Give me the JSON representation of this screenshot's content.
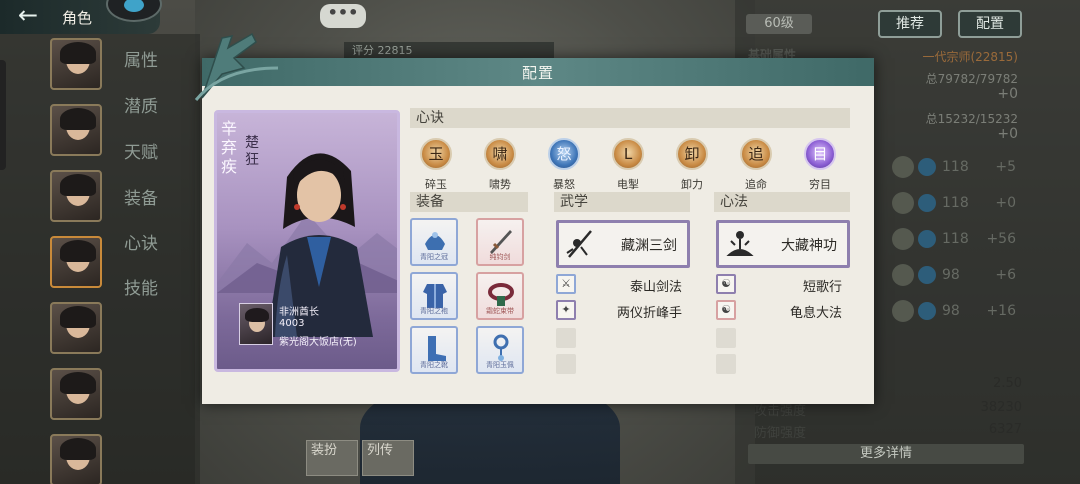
{
  "header": {
    "back_label": "←",
    "title": "角色"
  },
  "side_menu": [
    "属性",
    "潜质",
    "天赋",
    "装备",
    "心诀",
    "技能"
  ],
  "top_right": {
    "level": "60级",
    "recommend": "推荐",
    "config": "配置"
  },
  "chat_bubble": "•••",
  "score_text": "评分 22815",
  "stats_panel": {
    "heading": "基础属性",
    "rank": "一代宗师(22815)",
    "hp_line": "总79782/79782",
    "hp_delta": "+0",
    "mp_line": "总15232/15232",
    "mp_delta": "+0"
  },
  "wuxue_rows": [
    {
      "value": "118",
      "delta": "+5"
    },
    {
      "value": "118",
      "delta": "+0"
    },
    {
      "value": "118",
      "delta": "+56"
    },
    {
      "value": "98",
      "delta": "+6"
    },
    {
      "value": "98",
      "delta": "+16"
    }
  ],
  "lower_stats": [
    {
      "label": "",
      "value": "2.50"
    },
    {
      "label": "攻击强度",
      "value": "38230"
    },
    {
      "label": "防御强度",
      "value": "6327"
    }
  ],
  "more_details": "更多详情",
  "bottom_buttons": [
    "装扮",
    "列传"
  ],
  "modal": {
    "title": "配置",
    "character": {
      "name": "辛弃疾",
      "title": "楚狂",
      "owner_name": "非洲酋长",
      "owner_id": "4003",
      "owner_guild": "紫光阁大饭店(无)"
    },
    "xinjue_header": "心诀",
    "xinjue": [
      {
        "label": "碎玉",
        "glyph": "玉",
        "tone": "gold"
      },
      {
        "label": "啸势",
        "glyph": "啸",
        "tone": "gold"
      },
      {
        "label": "暴怒",
        "glyph": "怒",
        "tone": "blue"
      },
      {
        "label": "电掣",
        "glyph": "L",
        "tone": "gold"
      },
      {
        "label": "卸力",
        "glyph": "卸",
        "tone": "gold"
      },
      {
        "label": "追命",
        "glyph": "追",
        "tone": "gold"
      },
      {
        "label": "穷目",
        "glyph": "目",
        "tone": "purple"
      }
    ],
    "equip_header": "装备",
    "equipment": [
      {
        "name": "青阳之冠",
        "tone": "blue"
      },
      {
        "name": "纯钧剑",
        "tone": "red"
      },
      {
        "name": "青阳之袍",
        "tone": "blue"
      },
      {
        "name": "霜蛇束带",
        "tone": "red"
      },
      {
        "name": "青阳之靴",
        "tone": "blue"
      },
      {
        "name": "青阳玉佩",
        "tone": "blue"
      }
    ],
    "wuxue_header": "武学",
    "wuxue_main": "藏渊三剑",
    "wuxue_list": [
      {
        "name": "泰山剑法",
        "tone": "blue"
      },
      {
        "name": "两仪折峰手",
        "tone": "purple"
      }
    ],
    "xinfa_header": "心法",
    "xinfa_main": "大藏神功",
    "xinfa_list": [
      {
        "name": "短歌行",
        "tone": "purple"
      },
      {
        "name": "龟息大法",
        "tone": "red"
      }
    ]
  },
  "colors": {
    "header_teal": "#5e8886",
    "card_purple": "#a892c0",
    "blue_border": "#8fa7d6",
    "red_border": "#d7a1a1",
    "purple_border": "#8e7fae"
  }
}
